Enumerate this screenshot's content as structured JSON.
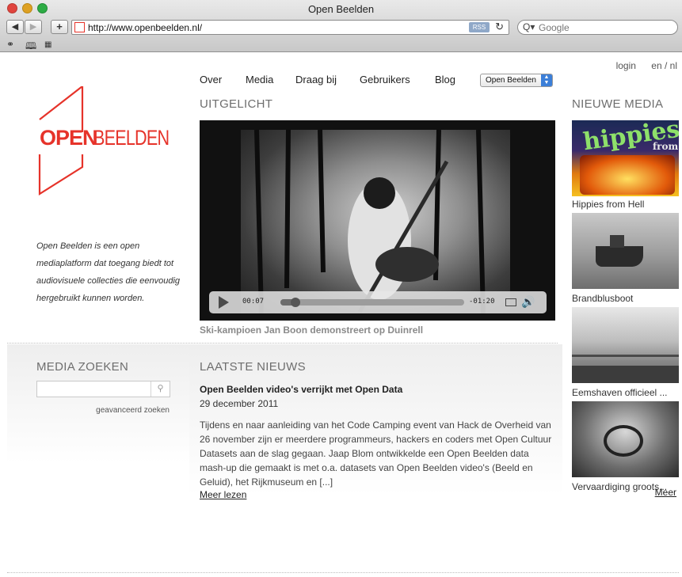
{
  "window": {
    "title": "Open Beelden"
  },
  "toolbar": {
    "url": "http://www.openbeelden.nl/",
    "rss_label": "RSS",
    "search_placeholder": "Google",
    "back_icon": "back-arrow-icon",
    "forward_icon": "forward-arrow-icon",
    "add_icon": "plus-icon"
  },
  "bookmarks": {
    "icons": [
      "reading-glasses-icon",
      "book-icon",
      "grid-icon"
    ]
  },
  "header": {
    "login": "login",
    "language": "en / nl"
  },
  "nav": {
    "items": [
      "Over",
      "Media",
      "Draag bij",
      "Gebruikers",
      "Blog"
    ],
    "site_select": "Open Beelden"
  },
  "logo": {
    "part1": "OPEN",
    "part2": "BEELDEN",
    "color": "#e6332a"
  },
  "intro": "Open Beelden is een open mediaplatform dat toegang biedt tot audiovisuele collecties die eenvoudig hergebruikt kunnen worden.",
  "featured": {
    "title": "UITGELICHT",
    "player": {
      "elapsed": "00:07",
      "remaining": "-01:20",
      "progress": 0.08
    },
    "caption": "Ski-kampioen Jan Boon demonstreert op Duinrell"
  },
  "search": {
    "title": "MEDIA ZOEKEN",
    "placeholder": "",
    "advanced": "geavanceerd zoeken"
  },
  "news": {
    "title": "LAATSTE NIEUWS",
    "headline": "Open Beelden video's verrijkt met Open Data",
    "date": "29 december 2011",
    "body": "Tijdens en naar aanleiding van het Code Camping event van Hack de Overheid van 26 november zijn er meerdere programmeurs, hackers en coders met Open Cultuur Datasets aan de slag gegaan. Jaap Blom ontwikkelde een Open Beelden data mash-up die gemaakt is met o.a. datasets van Open Beelden video's (Beeld en Geluid), het Rijkmuseum en [...]",
    "more": "Meer lezen"
  },
  "new_media": {
    "title": "NIEUWE MEDIA",
    "items": [
      {
        "label": "Hippies from Hell",
        "overlay": "hippies",
        "overlay2": "from"
      },
      {
        "label": "Brandblusboot"
      },
      {
        "label": "Eemshaven officieel ..."
      },
      {
        "label": "Vervaardiging groots..."
      }
    ],
    "more": "Meer"
  }
}
